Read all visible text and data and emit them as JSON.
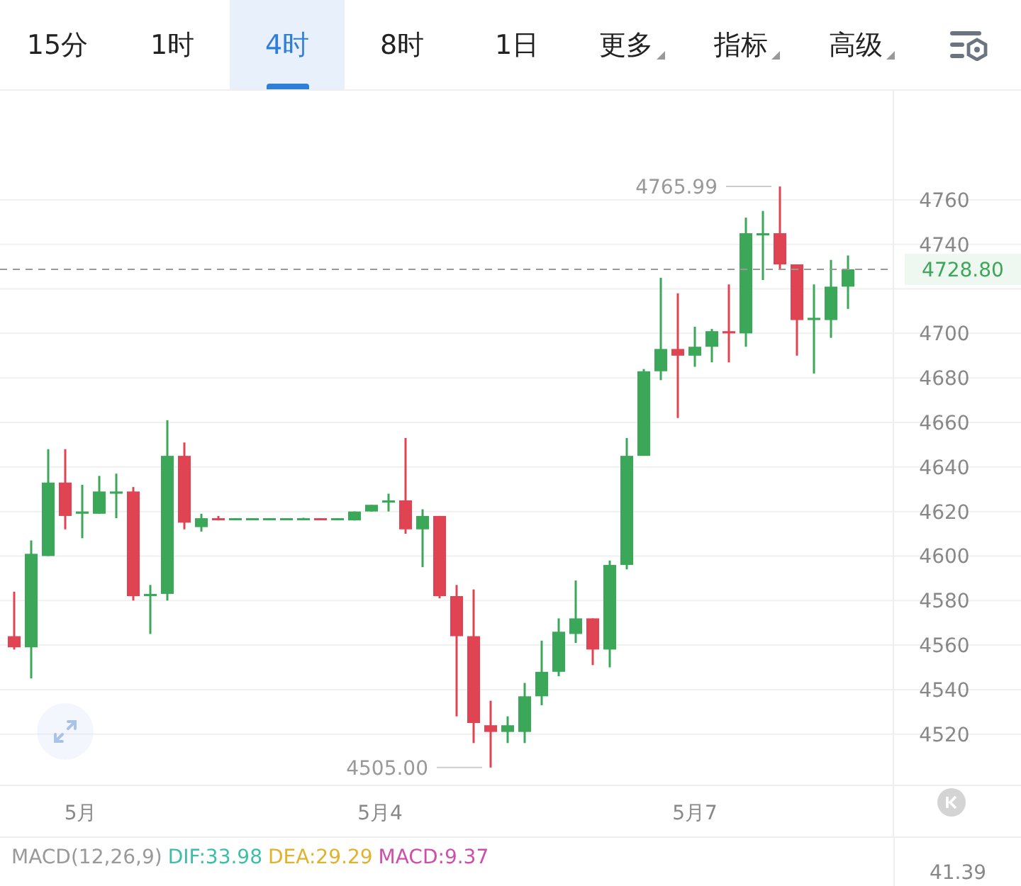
{
  "tabs": [
    {
      "kind": "tab",
      "label": "15分",
      "selected": false
    },
    {
      "kind": "tab",
      "label": "1时",
      "selected": false
    },
    {
      "kind": "tab",
      "label": "4时",
      "selected": true
    },
    {
      "kind": "tab",
      "label": "8时",
      "selected": false
    },
    {
      "kind": "tab",
      "label": "1日",
      "selected": false
    },
    {
      "kind": "menu",
      "label": "更多",
      "selected": false
    },
    {
      "kind": "menu",
      "label": "指标",
      "selected": false
    },
    {
      "kind": "menu",
      "label": "高级",
      "selected": false
    }
  ],
  "chart": {
    "chart_data": {
      "type": "candlestick",
      "grid": true,
      "ohlc": [
        [
          4564,
          4584,
          4558,
          4559
        ],
        [
          4559,
          4607,
          4545,
          4601
        ],
        [
          4600,
          4648,
          4600,
          4633
        ],
        [
          4633,
          4648,
          4612,
          4618
        ],
        [
          4619,
          4632,
          4608,
          4620
        ],
        [
          4619,
          4636,
          4619,
          4629
        ],
        [
          4628,
          4637,
          4617,
          4629
        ],
        [
          4629,
          4631,
          4580,
          4582
        ],
        [
          4582,
          4587,
          4565,
          4583
        ],
        [
          4583,
          4661,
          4580,
          4645
        ],
        [
          4645,
          4651,
          4612,
          4615
        ],
        [
          4613,
          4619,
          4611,
          4617
        ],
        [
          4617,
          4618,
          4616,
          4616.5
        ],
        [
          4616.5,
          4617,
          4616.5,
          4617
        ],
        [
          4616.8,
          4617,
          4616.8,
          4617
        ],
        [
          4616.8,
          4617,
          4616.8,
          4617
        ],
        [
          4616.8,
          4617,
          4616.8,
          4617
        ],
        [
          4616.8,
          4617.2,
          4616.6,
          4617
        ],
        [
          4617,
          4617,
          4616.5,
          4616.6
        ],
        [
          4616.6,
          4617,
          4616.5,
          4617
        ],
        [
          4616,
          4620,
          4616,
          4620
        ],
        [
          4620,
          4623,
          4620,
          4623
        ],
        [
          4624,
          4628,
          4620,
          4625
        ],
        [
          4625,
          4653,
          4610,
          4612
        ],
        [
          4612,
          4621,
          4595,
          4618
        ],
        [
          4618,
          4618,
          4581,
          4582
        ],
        [
          4582,
          4587,
          4528,
          4564
        ],
        [
          4564,
          4585,
          4516,
          4525
        ],
        [
          4524,
          4535,
          4505,
          4521
        ],
        [
          4521,
          4528,
          4516,
          4524
        ],
        [
          4521,
          4543,
          4516,
          4537
        ],
        [
          4537,
          4562,
          4533,
          4548
        ],
        [
          4548,
          4572,
          4546,
          4566
        ],
        [
          4565,
          4589,
          4561,
          4572
        ],
        [
          4572,
          4572,
          4551,
          4558
        ],
        [
          4558,
          4598,
          4550,
          4596
        ],
        [
          4596,
          4653,
          4594,
          4645
        ],
        [
          4645,
          4684,
          4645,
          4683
        ],
        [
          4683,
          4725,
          4679,
          4693
        ],
        [
          4693,
          4718,
          4662,
          4690
        ],
        [
          4690,
          4703,
          4685,
          4694
        ],
        [
          4694,
          4702,
          4687,
          4701
        ],
        [
          4701,
          4722,
          4687,
          4700
        ],
        [
          4700,
          4752,
          4694,
          4745
        ],
        [
          4744,
          4755,
          4724,
          4745
        ],
        [
          4745,
          4765.99,
          4729,
          4731
        ],
        [
          4731,
          4731,
          4690,
          4706
        ],
        [
          4706,
          4722,
          4682,
          4707
        ],
        [
          4706,
          4733,
          4698,
          4721
        ],
        [
          4721,
          4735,
          4711,
          4728.8
        ]
      ],
      "ylim": [
        4497,
        4809
      ],
      "yticks": [
        4520,
        4540,
        4560,
        4580,
        4600,
        4620,
        4640,
        4660,
        4680,
        4700,
        4740,
        4760
      ],
      "annotations": [
        "4765.99",
        "4505.00"
      ],
      "ref_lines": [
        {
          "axis": "y",
          "value": 4728.8,
          "label": "4728.80"
        }
      ]
    },
    "x_labels": [
      "5月",
      "5月4",
      "5月7"
    ]
  },
  "macd": {
    "label": "MACD(12,26,9)",
    "values": [
      {
        "text": "DIF:33.98",
        "color": "#3cbfa6"
      },
      {
        "text": "DEA:29.29",
        "color": "#e2b22c"
      },
      {
        "text": "MACD:9.37",
        "color": "#cf4fa8"
      }
    ],
    "axis_value": "41.39"
  }
}
